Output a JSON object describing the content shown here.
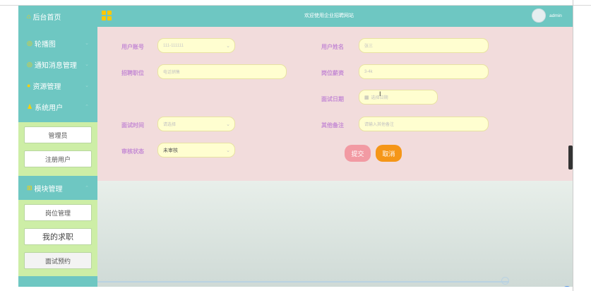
{
  "header": {
    "home_label": "后台首页",
    "welcome": "欢迎使用企业招聘网站",
    "user": "admin"
  },
  "sidebar": {
    "items": [
      {
        "label": "轮播图",
        "icon": "image-icon"
      },
      {
        "label": "通知消息管理",
        "icon": "bell-icon"
      },
      {
        "label": "资源管理",
        "icon": "folder-icon"
      },
      {
        "label": "系统用户",
        "icon": "user-icon"
      },
      {
        "label": "模块管理",
        "icon": "module-icon"
      }
    ],
    "system_users": [
      "管理员",
      "注册用户"
    ],
    "modules": [
      "岗位管理",
      "我的求职",
      "面试预约"
    ]
  },
  "form": {
    "account_label": "用户账号",
    "account_value": "111-111111",
    "username_label": "用户姓名",
    "username_placeholder": "张三",
    "position_label": "招聘职位",
    "position_placeholder": "电话销售",
    "salary_label": "岗位薪资",
    "salary_placeholder": "3-4k",
    "date_label": "面试日期",
    "date_placeholder": "选择日期",
    "time_label": "面试时间",
    "time_placeholder": "请选择",
    "remark_label": "其他备注",
    "remark_placeholder": "请输入其他备注",
    "status_label": "审核状态",
    "status_value": "未审核",
    "submit": "提交",
    "cancel": "取消"
  },
  "colors": {
    "header_bg": "#6ec7c2",
    "sidebar_bg": "#6ec7c2",
    "submenu_bg": "#cdeea6",
    "form_bg": "#f2dcdc",
    "label": "#c58bd4",
    "field_bg": "#fffed0",
    "submit": "#f29aa3",
    "cancel": "#f59618"
  }
}
